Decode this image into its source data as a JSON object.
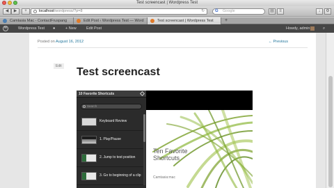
{
  "window": {
    "title": "Test screencast | Wordpress Test"
  },
  "colors": {
    "link": "#21759b",
    "adminbar_bg": "#464646",
    "traffic_red": "#ee5a52",
    "traffic_yellow": "#f5bd39",
    "traffic_green": "#5fc14d"
  },
  "toolbar": {
    "url_domain": "localhost",
    "url_path": "/wordpress/?p=8",
    "search_placeholder": "Google",
    "search_engine_letter": "G"
  },
  "tabs": [
    {
      "label": "Camtasia Mac - ContactFruspang",
      "active": false
    },
    {
      "label": "Edit Post ‹ Wordpress Test — Word",
      "active": false
    },
    {
      "label": "Test screencast | Wordpress Test",
      "active": true
    }
  ],
  "adminbar": {
    "site_name": "Wordpress Test",
    "new_label": "+ New",
    "edit_label": "Edit Post",
    "greeting": "Howdy, admin"
  },
  "post": {
    "posted_prefix": "Posted on",
    "date": "August 16, 2012",
    "prev_link": "← Previous",
    "edit_label": "Edit",
    "title": "Test screencast"
  },
  "video": {
    "header": "10 Favorite Shortcuts",
    "search_placeholder": "Search",
    "items": [
      {
        "label": "Keyboard Review"
      },
      {
        "label": "1. Play/Pause"
      },
      {
        "label": "2. Jump to test position"
      },
      {
        "label": "3. Go to beginning of a clip"
      }
    ],
    "cover_title": "Ten Favorite Shortcuts",
    "cover_brand": "Camtasia:mac"
  }
}
